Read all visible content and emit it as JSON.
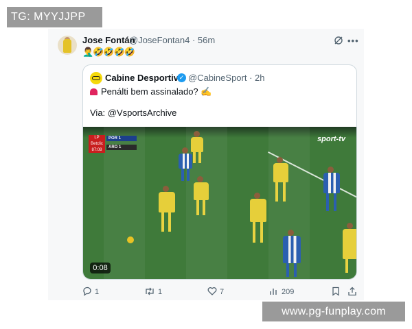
{
  "overlay": {
    "tg_label": "TG: MYYJJPP",
    "watermark": "www.pg-funplay.com"
  },
  "post": {
    "author_name": "Jose Fontán",
    "author_handle": "@JoseFontan4 · 56m",
    "text": "🤦‍♂️🤣🤣🤣🤣"
  },
  "quote": {
    "author_name": "Cabine Desportiva",
    "author_handle": "@CabineSport · 2h",
    "text_line1": "Penálti bem assinalado? ✍️",
    "text_line2": "Via: @VsportsArchive",
    "video": {
      "duration": "0:08",
      "channel_logo": "sport-tv",
      "scoreboard": {
        "home_team": "POR",
        "home_score": "1",
        "away_team": "ARO",
        "away_score": "1",
        "clock": "87:08",
        "badge": "LP",
        "sponsor": "Betclic"
      }
    }
  },
  "actions": {
    "replies": "1",
    "reposts": "1",
    "likes": "7",
    "views": "209"
  },
  "icons": {
    "reply": "reply-icon",
    "repost": "repost-icon",
    "like": "heart-icon",
    "views": "views-icon",
    "bookmark": "bookmark-icon",
    "share": "share-icon",
    "grok": "grok-icon",
    "more": "more-icon",
    "verified": "verified-badge-icon"
  },
  "colors": {
    "verified": "#1d9bf0",
    "secondary_text": "#536471",
    "border": "#cfd9de"
  }
}
